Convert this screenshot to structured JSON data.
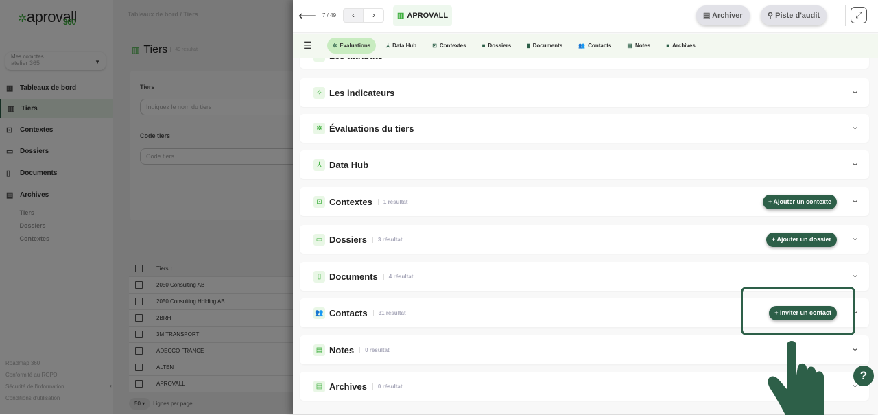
{
  "background": {
    "logo": {
      "text": "aprovall",
      "suffix": "360"
    },
    "breadcrumb": "Tableaux de bord / Tiers",
    "account": {
      "label": "Mes comptes",
      "value": "atelier 365"
    },
    "nav": [
      {
        "label": "Tableaux de bord",
        "icon": "dashboard-icon"
      },
      {
        "label": "Tiers",
        "icon": "building-icon"
      },
      {
        "label": "Contextes",
        "icon": "briefcase-icon"
      },
      {
        "label": "Dossiers",
        "icon": "folder-icon"
      },
      {
        "label": "Documents",
        "icon": "document-icon"
      },
      {
        "label": "Archives",
        "icon": "archive-icon"
      }
    ],
    "archive_sub": [
      "Tiers",
      "Dossiers",
      "Contextes"
    ],
    "footer": [
      "Roadmap 360",
      "Conformité au RGPD",
      "Sécurité de l'information",
      "Conditions d'utilisation"
    ],
    "page_title": "Tiers",
    "result_count": "49 résultat",
    "filters": [
      {
        "label": "Tiers",
        "placeholder": "Indiquez le nom du tiers"
      },
      {
        "label": "Code tiers",
        "placeholder": "Code tiers"
      }
    ],
    "table": {
      "header": "Tiers",
      "rows": [
        "2050 Consulting AB",
        "2050 Consulting Holding AB",
        "2BRH",
        "3M TRANSPORT",
        "ADECCO FRANCE",
        "ALTEN",
        "APROVALL"
      ]
    },
    "pager": {
      "value": "50",
      "label": "Lignes par page"
    }
  },
  "drawer": {
    "counter": "7 / 49",
    "entity": "APROVALL",
    "archive_button": "Archiver",
    "audit_button": "Piste d'audit",
    "tabs": [
      {
        "label": "Evaluations"
      },
      {
        "label": "Data Hub"
      },
      {
        "label": "Contextes"
      },
      {
        "label": "Dossiers"
      },
      {
        "label": "Documents"
      },
      {
        "label": "Contacts"
      },
      {
        "label": "Notes"
      },
      {
        "label": "Archives"
      }
    ],
    "sections": [
      {
        "title": "Les attributs",
        "count": ""
      },
      {
        "title": "Les indicateurs",
        "count": ""
      },
      {
        "title": "Évaluations du tiers",
        "count": ""
      },
      {
        "title": "Data Hub",
        "count": ""
      },
      {
        "title": "Contextes",
        "count": "1 résultat",
        "action": "Ajouter un contexte"
      },
      {
        "title": "Dossiers",
        "count": "3 résultat",
        "action": "Ajouter un dossier"
      },
      {
        "title": "Documents",
        "count": "4 résultat"
      },
      {
        "title": "Contacts",
        "count": "31 résultat",
        "action": "Inviter un contact"
      },
      {
        "title": "Notes",
        "count": "0 résultat"
      },
      {
        "title": "Archives",
        "count": "0 résultat"
      }
    ]
  },
  "help": "?",
  "colors": {
    "brand": "#2d5f48",
    "accent": "#3cae3c"
  }
}
